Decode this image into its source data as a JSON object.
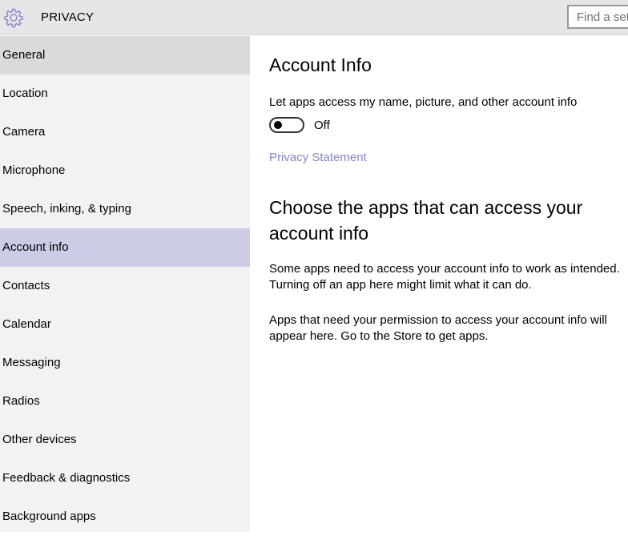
{
  "header": {
    "title": "PRIVACY",
    "settings_icon": "gear-icon",
    "search_placeholder": "Find a setting"
  },
  "sidebar": {
    "items": [
      {
        "label": "General",
        "state": "hovered"
      },
      {
        "label": "Location"
      },
      {
        "label": "Camera"
      },
      {
        "label": "Microphone"
      },
      {
        "label": "Speech, inking, & typing"
      },
      {
        "label": "Account info",
        "state": "selected"
      },
      {
        "label": "Contacts"
      },
      {
        "label": "Calendar"
      },
      {
        "label": "Messaging"
      },
      {
        "label": "Radios"
      },
      {
        "label": "Other devices"
      },
      {
        "label": "Feedback & diagnostics"
      },
      {
        "label": "Background apps"
      }
    ]
  },
  "main": {
    "section_title": "Account Info",
    "toggle_label": "Let apps access my name, picture, and other account info",
    "toggle_state": "Off",
    "privacy_link": "Privacy Statement",
    "apps_title": "Choose the apps that can access your account info",
    "description": "Some apps need to access your account info to work as intended. Turning off an app here might limit what it can do.",
    "empty_message": "Apps that need your permission to access your account info will appear here. Go to the Store to get apps."
  },
  "colors": {
    "header_bg": "#e6e6e6",
    "sidebar_bg": "#f2f2f2",
    "hover_bg": "#dadada",
    "selected_bg": "#cccce6",
    "accent": "#8686c8"
  }
}
